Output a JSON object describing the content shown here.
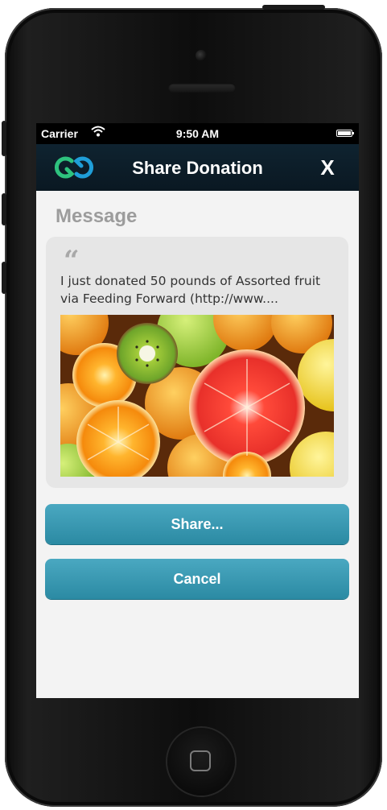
{
  "status_bar": {
    "carrier": "Carrier",
    "time": "9:50 AM"
  },
  "nav": {
    "title": "Share Donation",
    "close_label": "X"
  },
  "message": {
    "section_title": "Message",
    "quote_mark": "“",
    "text": "I just donated 50 pounds of Assorted fruit via Feeding Forward (http://www...."
  },
  "buttons": {
    "share_label": "Share...",
    "cancel_label": "Cancel"
  },
  "colors": {
    "nav_background": "#0f2330",
    "button_background": "#3a9bb4",
    "logo_green": "#2ec27e",
    "logo_blue": "#1f9ed8"
  },
  "icons": {
    "logo": "feeding-forward-logo",
    "wifi": "wifi-icon",
    "battery": "battery-icon"
  }
}
